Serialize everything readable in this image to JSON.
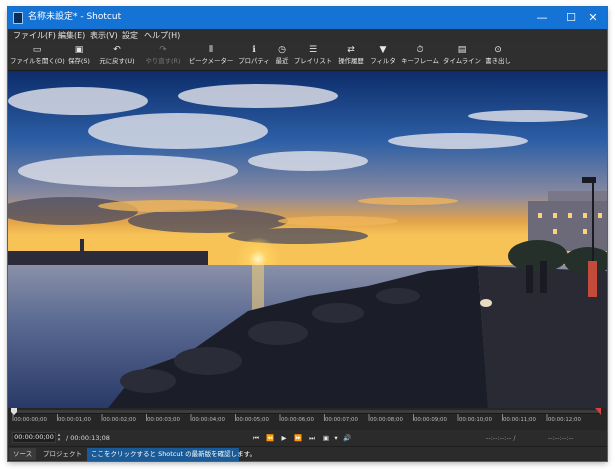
{
  "window": {
    "title": "名称未設定* - Shotcut",
    "minimize_label": "—",
    "maximize_label": "☐",
    "close_label": "✕"
  },
  "menu": {
    "items": [
      {
        "label": "ファイル(F)"
      },
      {
        "label": "編集(E)"
      },
      {
        "label": "表示(V)"
      },
      {
        "label": "設定"
      },
      {
        "label": "ヘルプ(H)"
      }
    ]
  },
  "toolbar": {
    "items": [
      {
        "icon": "folder-open-icon",
        "glyph": "▭",
        "label": "ファイルを開く(O)",
        "enabled": true
      },
      {
        "icon": "save-icon",
        "glyph": "▣",
        "label": "保存(S)",
        "enabled": true
      },
      {
        "icon": "undo-icon",
        "glyph": "↶",
        "label": "元に戻す(U)",
        "enabled": true
      },
      {
        "icon": "redo-icon",
        "glyph": "↷",
        "label": "やり直す(R)",
        "enabled": false
      },
      {
        "icon": "peak-meter-icon",
        "glyph": "⫴",
        "label": "ピークメーター",
        "enabled": true
      },
      {
        "icon": "properties-icon",
        "glyph": "ℹ",
        "label": "プロパティ",
        "enabled": true
      },
      {
        "icon": "recent-icon",
        "glyph": "◷",
        "label": "最近",
        "enabled": true
      },
      {
        "icon": "playlist-icon",
        "glyph": "☰",
        "label": "プレイリスト",
        "enabled": true
      },
      {
        "icon": "history-icon",
        "glyph": "⇄",
        "label": "操作履歴",
        "enabled": true
      },
      {
        "icon": "filter-icon",
        "glyph": "▼",
        "label": "フィルタ",
        "enabled": true
      },
      {
        "icon": "keyframes-icon",
        "glyph": "⏱",
        "label": "キーフレーム",
        "enabled": true
      },
      {
        "icon": "timeline-icon",
        "glyph": "▤",
        "label": "タイムライン",
        "enabled": true
      },
      {
        "icon": "export-icon",
        "glyph": "⊙",
        "label": "書き出し",
        "enabled": true
      }
    ]
  },
  "ruler": {
    "tick_labels": [
      "00:00:00;00",
      "00:00:01;00",
      "00:00:02;00",
      "00:00:03;00",
      "00:00:04;00",
      "00:00:05;00",
      "00:00:06;00",
      "00:00:07;00",
      "00:00:08;00",
      "00:00:09;00",
      "00:00:10;00",
      "00:00:11;00",
      "00:00:12;00"
    ]
  },
  "transport": {
    "current_time": "00:00:00;00",
    "duration": "/ 00:00:13;08",
    "buttons": [
      {
        "icon": "skip-to-start-icon",
        "glyph": "⏮"
      },
      {
        "icon": "rewind-icon",
        "glyph": "⏪"
      },
      {
        "icon": "play-icon",
        "glyph": "▶"
      },
      {
        "icon": "fast-forward-icon",
        "glyph": "⏩"
      },
      {
        "icon": "skip-to-end-icon",
        "glyph": "⏭"
      },
      {
        "icon": "grid-icon",
        "glyph": "▣"
      },
      {
        "icon": "dropdown-arrow-icon",
        "glyph": "▾"
      },
      {
        "icon": "volume-icon",
        "glyph": "🔊"
      }
    ],
    "in_point": "--:--:--:-- /",
    "out_point": "--:--:--:--"
  },
  "bottom_tabs": {
    "source": "ソース",
    "project": "プロジェクト",
    "update_notice": "ここをクリックすると Shotcut の最新版を確認します。"
  },
  "colors": {
    "titlebar": "#1673d6",
    "toolbar": "#2f2f2f",
    "playhead": "#e0e0e0",
    "notice": "#1a5a96"
  }
}
